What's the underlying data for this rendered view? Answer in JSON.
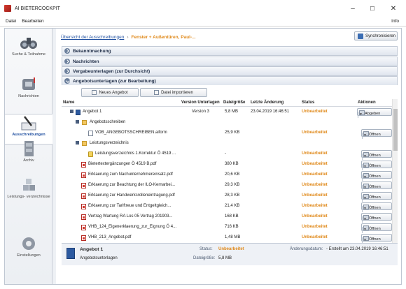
{
  "window": {
    "title": "AI BIETERCOCKPIT",
    "minimize": "–",
    "maximize": "☐",
    "close": "✕"
  },
  "menu": {
    "items": [
      "Datei",
      "Bearbeiten"
    ],
    "info": "Info"
  },
  "sidebar": {
    "items": [
      {
        "label": "Suche & Teilnahme"
      },
      {
        "label": "Nachrichten"
      },
      {
        "label": "Ausschreibungen",
        "active": true
      },
      {
        "label": "Archiv"
      },
      {
        "label": "Leistungs- verzeichnisse"
      },
      {
        "label": "Einstellungen"
      }
    ]
  },
  "breadcrumb": {
    "link": "Übersicht der Ausschreibungen",
    "separator": "›",
    "current": "Fenster + Außentüren, Paul-..."
  },
  "sync_button": "Synchronisieren",
  "sections": [
    {
      "label": "Bekanntmachung",
      "open": false
    },
    {
      "label": "Nachrichten",
      "open": false
    },
    {
      "label": "Vergabeunterlagen (zur Durchsicht)",
      "open": false
    },
    {
      "label": "Angebotsunterlagen (zur Bearbeitung)",
      "open": true
    }
  ],
  "toolbar": {
    "new_offer": "Neues Angebot",
    "import_file": "Datei importieren"
  },
  "columns": {
    "name": "Name",
    "version": "Version Unterlagen",
    "size": "Dateigröße",
    "changed": "Letzte Änderung",
    "status": "Status",
    "actions": "Aktionen"
  },
  "rows": [
    {
      "name": "Angebot 1",
      "version": "Version 3",
      "size": "5,8 MB",
      "changed": "23.04.2019 16:46:51",
      "status": "Unbearbeitet",
      "action": "Abgeben"
    },
    {
      "name": "Angebotsschreiben",
      "version": "",
      "size": "",
      "changed": "",
      "status": "",
      "action": ""
    },
    {
      "name": "VOB_ANGEBOTSSCHREIBEN.aiform",
      "version": "",
      "size": "25,9 KB",
      "changed": "",
      "status": "Unbearbeitet",
      "action": "Öffnen"
    },
    {
      "name": "Leistungsverzeichnis",
      "version": "",
      "size": "",
      "changed": "",
      "status": "",
      "action": ""
    },
    {
      "name": "Leistungsverzeichnis 1.Korrektur Ö 4519 ...",
      "version": "",
      "size": "-",
      "changed": "",
      "status": "Unbearbeitet",
      "action": "Öffnen"
    },
    {
      "name": "Bietertextergänzungen Ö 4519 B.pdf",
      "version": "",
      "size": "380 KB",
      "changed": "",
      "status": "Unbearbeitet",
      "action": "Öffnen"
    },
    {
      "name": "Erklaerung zum Nachunternehmereinsatz.pdf",
      "version": "",
      "size": "20,6 KB",
      "changed": "",
      "status": "Unbearbeitet",
      "action": "Öffnen"
    },
    {
      "name": "Erklaerung zur Beachtung der ILO-Kernarbei...",
      "version": "",
      "size": "29,3 KB",
      "changed": "",
      "status": "Unbearbeitet",
      "action": "Öffnen"
    },
    {
      "name": "Erklaerung zur Handwerksrolleneintragung.pdf",
      "version": "",
      "size": "28,3 KB",
      "changed": "",
      "status": "Unbearbeitet",
      "action": "Öffnen"
    },
    {
      "name": "Erklaerung zur Tariftreue und Entgeltgleich...",
      "version": "",
      "size": "21,4 KB",
      "changed": "",
      "status": "Unbearbeitet",
      "action": "Öffnen"
    },
    {
      "name": "Vertrag Wartung RA Los 05 Vertrag 201903...",
      "version": "",
      "size": "168 KB",
      "changed": "",
      "status": "Unbearbeitet",
      "action": "Öffnen"
    },
    {
      "name": "VHB_124_Eigenerklaerung_zur_Eignung Ö 4...",
      "version": "",
      "size": "716 KB",
      "changed": "",
      "status": "Unbearbeitet",
      "action": "Öffnen"
    },
    {
      "name": "VHB_213_Angebot.pdf",
      "version": "",
      "size": "1,48 MB",
      "changed": "",
      "status": "Unbearbeitet",
      "action": "Öffnen"
    }
  ],
  "details": {
    "title": "Angebot 1",
    "subtitle": "Angebotsunterlagen",
    "status_label": "Status:",
    "status_value": "Unbearbeitet",
    "size_label": "Dateigröße:",
    "size_value": "5,8 MB",
    "changed_label": "Änderungsdatum:",
    "changed_value": "- Erstellt am 23.04.2019 16:46:51"
  }
}
